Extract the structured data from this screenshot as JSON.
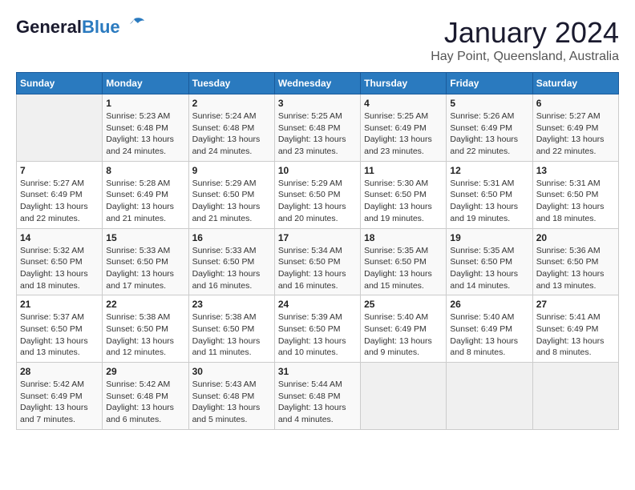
{
  "header": {
    "logo_general": "General",
    "logo_blue": "Blue",
    "title": "January 2024",
    "subtitle": "Hay Point, Queensland, Australia"
  },
  "columns": [
    "Sunday",
    "Monday",
    "Tuesday",
    "Wednesday",
    "Thursday",
    "Friday",
    "Saturday"
  ],
  "weeks": [
    [
      {
        "day": "",
        "info": ""
      },
      {
        "day": "1",
        "info": "Sunrise: 5:23 AM\nSunset: 6:48 PM\nDaylight: 13 hours\nand 24 minutes."
      },
      {
        "day": "2",
        "info": "Sunrise: 5:24 AM\nSunset: 6:48 PM\nDaylight: 13 hours\nand 24 minutes."
      },
      {
        "day": "3",
        "info": "Sunrise: 5:25 AM\nSunset: 6:48 PM\nDaylight: 13 hours\nand 23 minutes."
      },
      {
        "day": "4",
        "info": "Sunrise: 5:25 AM\nSunset: 6:49 PM\nDaylight: 13 hours\nand 23 minutes."
      },
      {
        "day": "5",
        "info": "Sunrise: 5:26 AM\nSunset: 6:49 PM\nDaylight: 13 hours\nand 22 minutes."
      },
      {
        "day": "6",
        "info": "Sunrise: 5:27 AM\nSunset: 6:49 PM\nDaylight: 13 hours\nand 22 minutes."
      }
    ],
    [
      {
        "day": "7",
        "info": "Sunrise: 5:27 AM\nSunset: 6:49 PM\nDaylight: 13 hours\nand 22 minutes."
      },
      {
        "day": "8",
        "info": "Sunrise: 5:28 AM\nSunset: 6:49 PM\nDaylight: 13 hours\nand 21 minutes."
      },
      {
        "day": "9",
        "info": "Sunrise: 5:29 AM\nSunset: 6:50 PM\nDaylight: 13 hours\nand 21 minutes."
      },
      {
        "day": "10",
        "info": "Sunrise: 5:29 AM\nSunset: 6:50 PM\nDaylight: 13 hours\nand 20 minutes."
      },
      {
        "day": "11",
        "info": "Sunrise: 5:30 AM\nSunset: 6:50 PM\nDaylight: 13 hours\nand 19 minutes."
      },
      {
        "day": "12",
        "info": "Sunrise: 5:31 AM\nSunset: 6:50 PM\nDaylight: 13 hours\nand 19 minutes."
      },
      {
        "day": "13",
        "info": "Sunrise: 5:31 AM\nSunset: 6:50 PM\nDaylight: 13 hours\nand 18 minutes."
      }
    ],
    [
      {
        "day": "14",
        "info": "Sunrise: 5:32 AM\nSunset: 6:50 PM\nDaylight: 13 hours\nand 18 minutes."
      },
      {
        "day": "15",
        "info": "Sunrise: 5:33 AM\nSunset: 6:50 PM\nDaylight: 13 hours\nand 17 minutes."
      },
      {
        "day": "16",
        "info": "Sunrise: 5:33 AM\nSunset: 6:50 PM\nDaylight: 13 hours\nand 16 minutes."
      },
      {
        "day": "17",
        "info": "Sunrise: 5:34 AM\nSunset: 6:50 PM\nDaylight: 13 hours\nand 16 minutes."
      },
      {
        "day": "18",
        "info": "Sunrise: 5:35 AM\nSunset: 6:50 PM\nDaylight: 13 hours\nand 15 minutes."
      },
      {
        "day": "19",
        "info": "Sunrise: 5:35 AM\nSunset: 6:50 PM\nDaylight: 13 hours\nand 14 minutes."
      },
      {
        "day": "20",
        "info": "Sunrise: 5:36 AM\nSunset: 6:50 PM\nDaylight: 13 hours\nand 13 minutes."
      }
    ],
    [
      {
        "day": "21",
        "info": "Sunrise: 5:37 AM\nSunset: 6:50 PM\nDaylight: 13 hours\nand 13 minutes."
      },
      {
        "day": "22",
        "info": "Sunrise: 5:38 AM\nSunset: 6:50 PM\nDaylight: 13 hours\nand 12 minutes."
      },
      {
        "day": "23",
        "info": "Sunrise: 5:38 AM\nSunset: 6:50 PM\nDaylight: 13 hours\nand 11 minutes."
      },
      {
        "day": "24",
        "info": "Sunrise: 5:39 AM\nSunset: 6:50 PM\nDaylight: 13 hours\nand 10 minutes."
      },
      {
        "day": "25",
        "info": "Sunrise: 5:40 AM\nSunset: 6:49 PM\nDaylight: 13 hours\nand 9 minutes."
      },
      {
        "day": "26",
        "info": "Sunrise: 5:40 AM\nSunset: 6:49 PM\nDaylight: 13 hours\nand 8 minutes."
      },
      {
        "day": "27",
        "info": "Sunrise: 5:41 AM\nSunset: 6:49 PM\nDaylight: 13 hours\nand 8 minutes."
      }
    ],
    [
      {
        "day": "28",
        "info": "Sunrise: 5:42 AM\nSunset: 6:49 PM\nDaylight: 13 hours\nand 7 minutes."
      },
      {
        "day": "29",
        "info": "Sunrise: 5:42 AM\nSunset: 6:48 PM\nDaylight: 13 hours\nand 6 minutes."
      },
      {
        "day": "30",
        "info": "Sunrise: 5:43 AM\nSunset: 6:48 PM\nDaylight: 13 hours\nand 5 minutes."
      },
      {
        "day": "31",
        "info": "Sunrise: 5:44 AM\nSunset: 6:48 PM\nDaylight: 13 hours\nand 4 minutes."
      },
      {
        "day": "",
        "info": ""
      },
      {
        "day": "",
        "info": ""
      },
      {
        "day": "",
        "info": ""
      }
    ]
  ]
}
